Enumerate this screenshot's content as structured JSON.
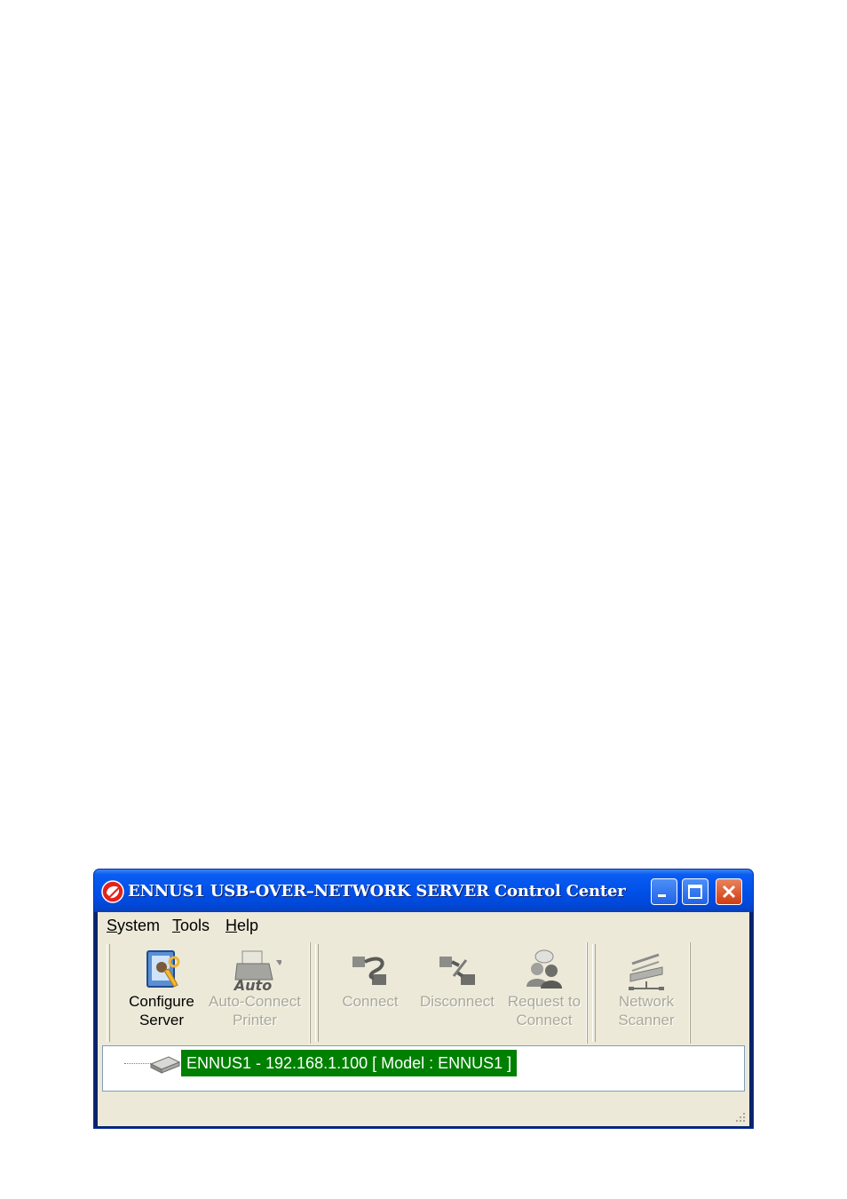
{
  "window": {
    "title": "ENNUS1 USB-OVER–NETWORK  SERVER Control Center",
    "colors": {
      "titlebar": "#0050e8",
      "client": "#ece9d8",
      "selection": "#008000",
      "close": "#d13c12"
    }
  },
  "menu": [
    {
      "label_first": "S",
      "label_rest": "ystem"
    },
    {
      "label_first": "T",
      "label_rest": "ools"
    },
    {
      "label_first": "H",
      "label_rest": "elp"
    }
  ],
  "toolbar": {
    "configure_server": {
      "label": "Configure\nServer",
      "icon": "configure-server-icon",
      "enabled": true
    },
    "auto_connect_printer": {
      "label": "Auto-Connect\nPrinter",
      "icon_text": "Auto",
      "icon": "auto-connect-printer-icon",
      "enabled": false
    },
    "connect": {
      "label": "Connect",
      "icon": "connect-icon",
      "enabled": false
    },
    "disconnect": {
      "label": "Disconnect",
      "icon": "disconnect-icon",
      "enabled": false
    },
    "request_to_connect": {
      "label": "Request to\nConnect",
      "icon": "request-connect-icon",
      "enabled": false
    },
    "network_scanner": {
      "label": "Network\nScanner",
      "icon": "network-scanner-icon",
      "enabled": false
    }
  },
  "tree": {
    "nodes": [
      {
        "label": "ENNUS1 - 192.168.1.100 [ Model : ENNUS1 ]",
        "selected": true,
        "icon": "usb-server-icon"
      }
    ]
  }
}
